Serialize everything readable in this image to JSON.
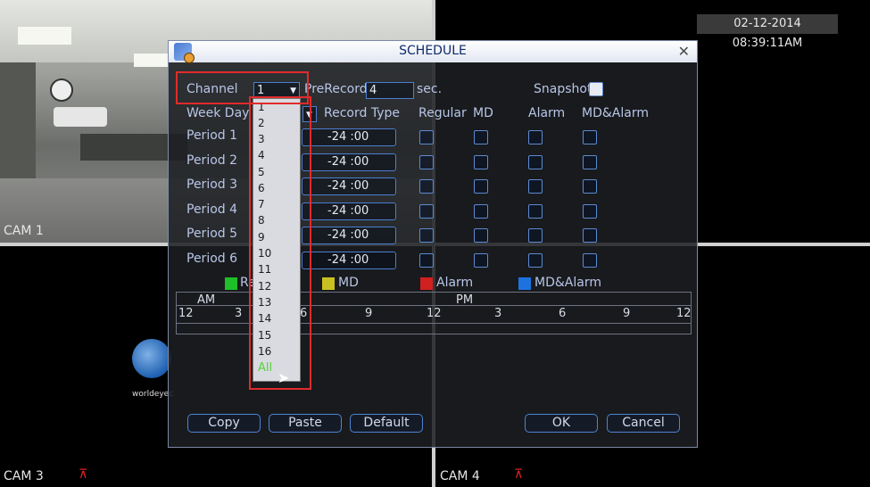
{
  "overlay": {
    "datetime": "02-12-2014 08:39:11AM",
    "cameras": [
      {
        "label": "CAM 1"
      },
      {
        "label": "CAM 3"
      },
      {
        "label": "CAM 4"
      }
    ],
    "logo_text": "worldeyec"
  },
  "dialog": {
    "title": "SCHEDULE",
    "channel_label": "Channel",
    "channel_value": "1",
    "prerecord_label": "PreRecord",
    "prerecord_value": "4",
    "prerecord_unit": "sec.",
    "snapshot_label": "Snapshot",
    "weekday_label": "Week Day",
    "headers": {
      "record_type": "Record Type",
      "regular": "Regular",
      "md": "MD",
      "alarm": "Alarm",
      "md_alarm": "MD&Alarm"
    },
    "periods": [
      {
        "label": "Period 1",
        "time": "-24 :00"
      },
      {
        "label": "Period 2",
        "time": "-24 :00"
      },
      {
        "label": "Period 3",
        "time": "-24 :00"
      },
      {
        "label": "Period 4",
        "time": "-24 :00"
      },
      {
        "label": "Period 5",
        "time": "-24 :00"
      },
      {
        "label": "Period 6",
        "time": "-24 :00"
      }
    ],
    "legend": [
      {
        "label": "Re",
        "color": "#1fbf2a"
      },
      {
        "label": "MD",
        "color": "#c8c020"
      },
      {
        "label": "Alarm",
        "color": "#d02020"
      },
      {
        "label": "MD&Alarm",
        "color": "#1e72e0"
      }
    ],
    "timeline": {
      "am_label": "AM",
      "pm_label": "PM",
      "ticks": [
        "12",
        "3",
        "6",
        "9",
        "12",
        "3",
        "6",
        "9",
        "12"
      ]
    },
    "buttons": {
      "copy": "Copy",
      "paste": "Paste",
      "default": "Default",
      "ok": "OK",
      "cancel": "Cancel"
    },
    "channel_options": [
      "1",
      "2",
      "3",
      "4",
      "5",
      "6",
      "7",
      "8",
      "9",
      "10",
      "11",
      "12",
      "13",
      "14",
      "15",
      "16",
      "All"
    ]
  }
}
